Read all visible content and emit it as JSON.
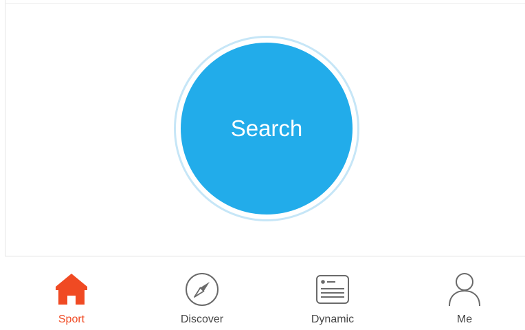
{
  "colors": {
    "accent": "#22acea",
    "active": "#f04a23",
    "inactive_icon": "#6a6a6a",
    "inactive_label": "#444444"
  },
  "main": {
    "search_label": "Search"
  },
  "tabbar": {
    "active_index": 0,
    "tabs": [
      {
        "label": "Sport",
        "icon": "home-icon"
      },
      {
        "label": "Discover",
        "icon": "compass-icon"
      },
      {
        "label": "Dynamic",
        "icon": "news-card-icon"
      },
      {
        "label": "Me",
        "icon": "person-icon"
      }
    ]
  }
}
